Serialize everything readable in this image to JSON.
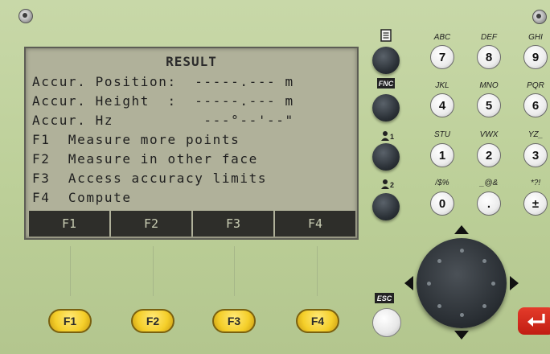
{
  "screen": {
    "title": "RESULT",
    "lines": [
      "Accur. Position:  -----.--- m",
      "Accur. Height  :  -----.--- m",
      "Accur. Hz          ---°--'--\"",
      "F1  Measure more points",
      "F2  Measure in other face",
      "F3  Access accuracy limits",
      "F4  Compute"
    ],
    "softkeys": [
      "F1",
      "F2",
      "F3",
      "F4"
    ]
  },
  "function_keys": [
    "F1",
    "F2",
    "F3",
    "F4"
  ],
  "side_keys": {
    "fnc_label": "FNC",
    "esc_label": "ESC",
    "user1_label": "1",
    "user2_label": "2"
  },
  "numpad": {
    "keys": [
      {
        "label": "7",
        "caption": "ABC"
      },
      {
        "label": "8",
        "caption": "DEF"
      },
      {
        "label": "9",
        "caption": "GHI"
      },
      {
        "label": "4",
        "caption": "JKL"
      },
      {
        "label": "5",
        "caption": "MNO"
      },
      {
        "label": "6",
        "caption": "PQR"
      },
      {
        "label": "1",
        "caption": "STU"
      },
      {
        "label": "2",
        "caption": "VWX"
      },
      {
        "label": "3",
        "caption": "YZ_"
      },
      {
        "label": "0",
        "caption": "/$%"
      },
      {
        "label": ".",
        "caption": "_@&"
      },
      {
        "label": "±",
        "caption": "*?!"
      }
    ]
  },
  "colors": {
    "panel": "#bccf98",
    "lcd": "#b0b19a",
    "softkey_bar": "#2e2e2a",
    "function_key": "#f5cf2a",
    "enter_key": "#d42c1e"
  }
}
